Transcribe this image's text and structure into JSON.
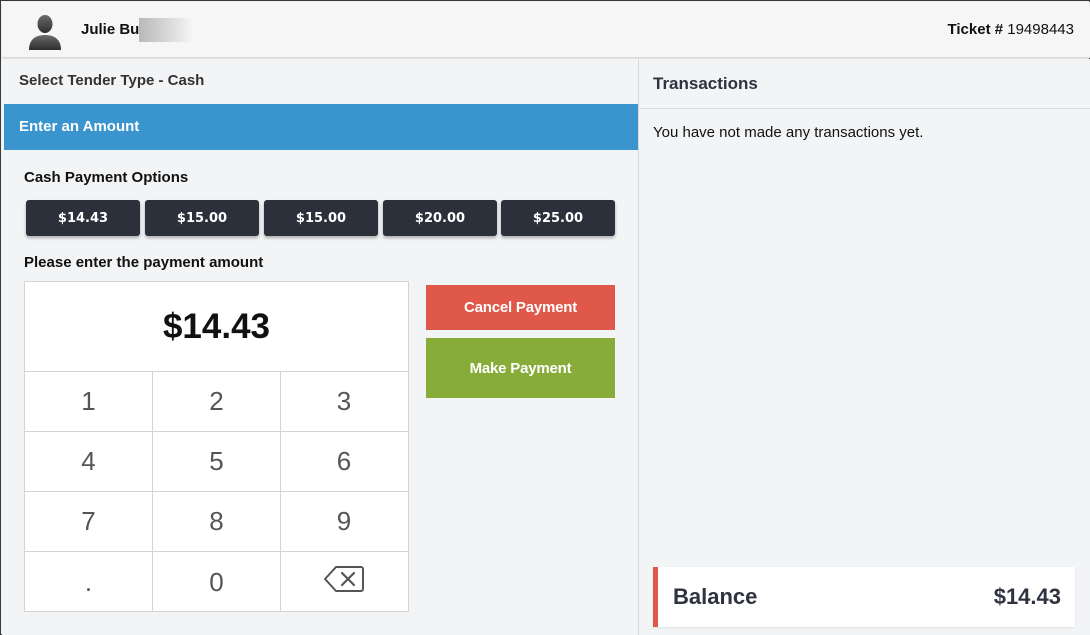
{
  "header": {
    "user_name": "Julie Bu",
    "ticket_label": "Ticket #",
    "ticket_number": "19498443"
  },
  "left": {
    "tender_title": "Select Tender Type - Cash",
    "enter_amount": "Enter an Amount",
    "options_title": "Cash Payment Options",
    "options": [
      "$14.43",
      "$15.00",
      "$15.00",
      "$20.00",
      "$25.00"
    ],
    "amount_title": "Please enter the payment amount",
    "amount_value": "$14.43",
    "keys": [
      "1",
      "2",
      "3",
      "4",
      "5",
      "6",
      "7",
      "8",
      "9",
      ".",
      "0"
    ],
    "cancel_label": "Cancel Payment",
    "make_label": "Make Payment"
  },
  "right": {
    "title": "Transactions",
    "empty_message": "You have not made any transactions yet.",
    "balance_label": "Balance",
    "balance_value": "$14.43"
  },
  "colors": {
    "accent_blue": "#3a95ce",
    "cancel_red": "#e0584a",
    "make_green": "#88ac3a",
    "option_dark": "#2b303b"
  },
  "icons": {
    "avatar": "user-silhouette-icon",
    "backspace": "backspace-icon"
  }
}
